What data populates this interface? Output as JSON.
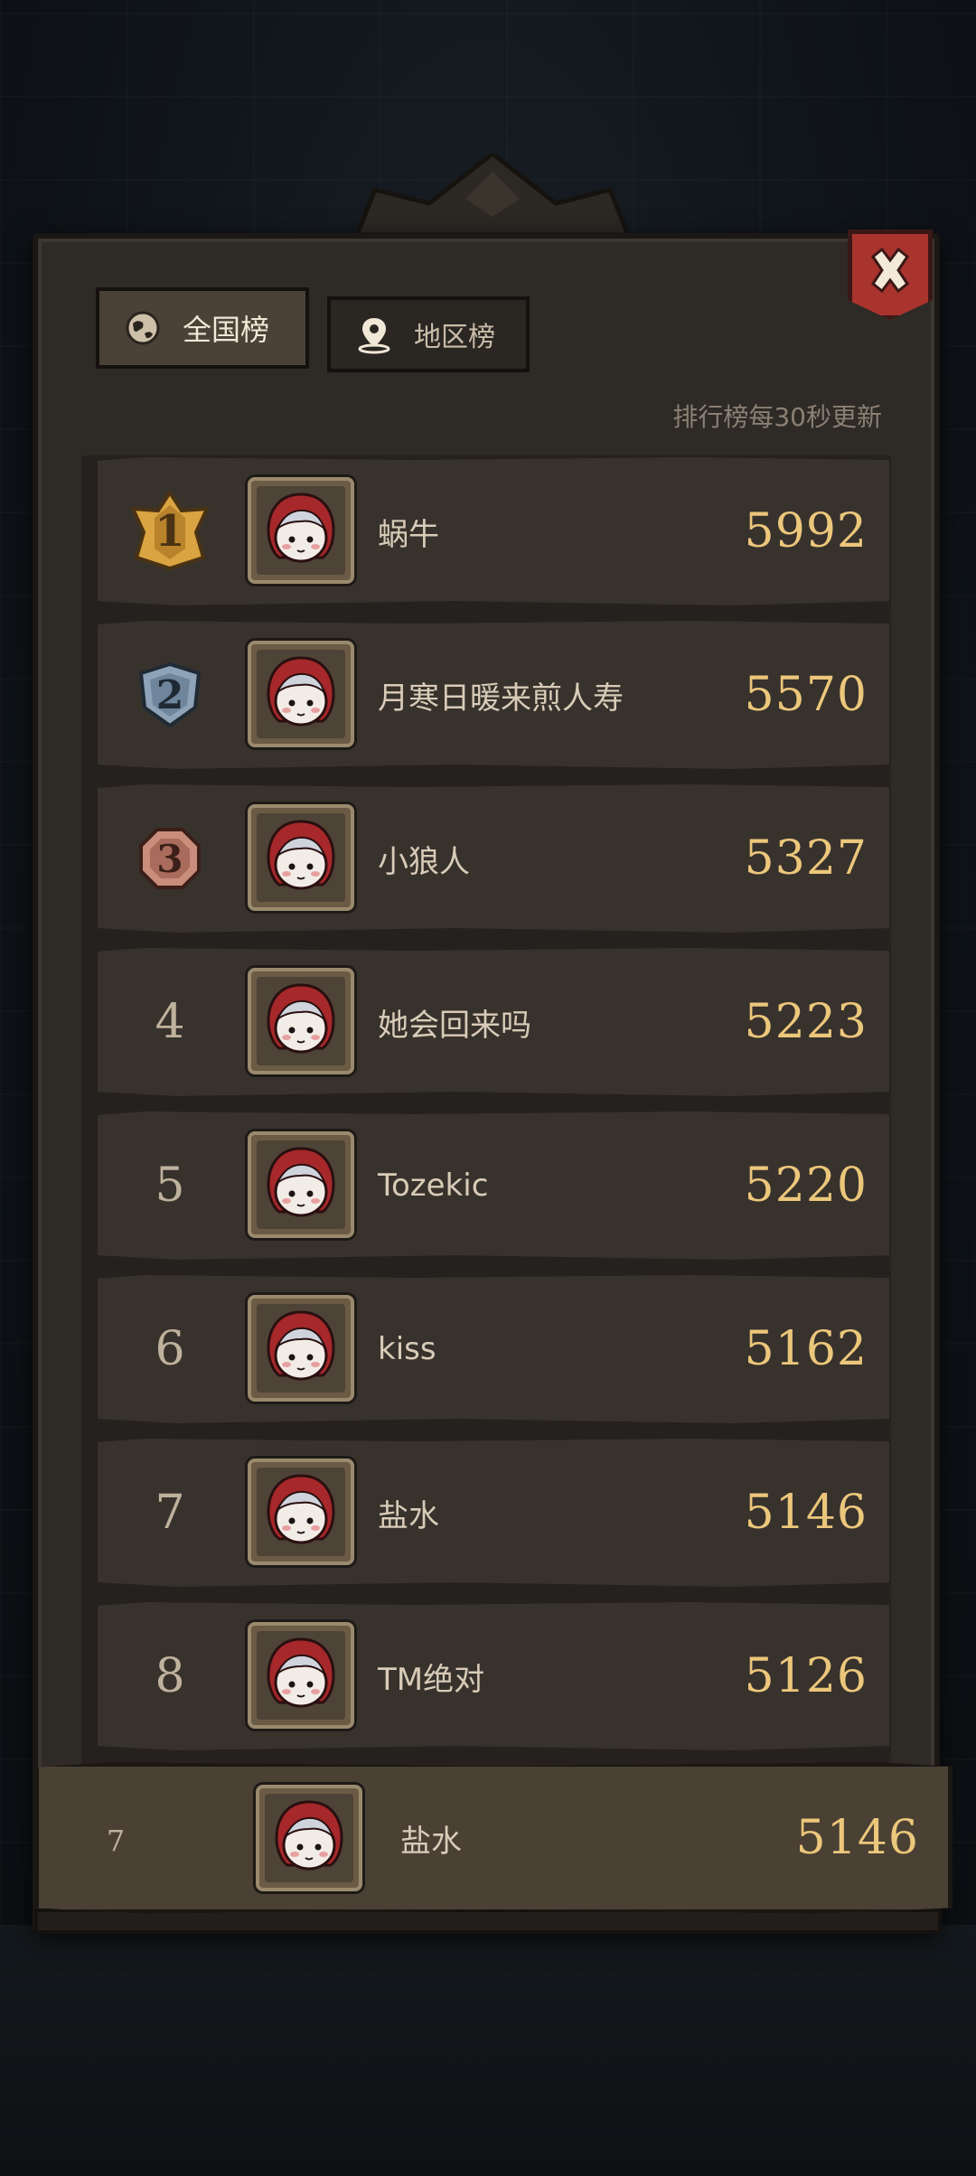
{
  "tabs": {
    "national": "全国榜",
    "regional": "地区榜"
  },
  "update_note": "排行榜每30秒更新",
  "leaderboard": [
    {
      "rank": "1",
      "name": "蜗牛",
      "score": "5992"
    },
    {
      "rank": "2",
      "name": "月寒日暖来煎人寿",
      "score": "5570"
    },
    {
      "rank": "3",
      "name": "小狼人",
      "score": "5327"
    },
    {
      "rank": "4",
      "name": "她会回来吗",
      "score": "5223"
    },
    {
      "rank": "5",
      "name": "Tozekic",
      "score": "5220"
    },
    {
      "rank": "6",
      "name": "kiss",
      "score": "5162"
    },
    {
      "rank": "7",
      "name": "盐水",
      "score": "5146"
    },
    {
      "rank": "8",
      "name": "TM绝对",
      "score": "5126"
    }
  ],
  "my_rank": {
    "rank": "7",
    "name": "盐水",
    "score": "5146"
  },
  "colors": {
    "gold": "#ecc77b",
    "close_red": "#a9332d",
    "medal_gold": "#d9a441",
    "medal_silver": "#8fa3b8",
    "medal_bronze": "#c98d7c"
  },
  "icons": {
    "close": "close-x-icon",
    "national": "globe-icon",
    "regional": "location-pin-icon"
  }
}
